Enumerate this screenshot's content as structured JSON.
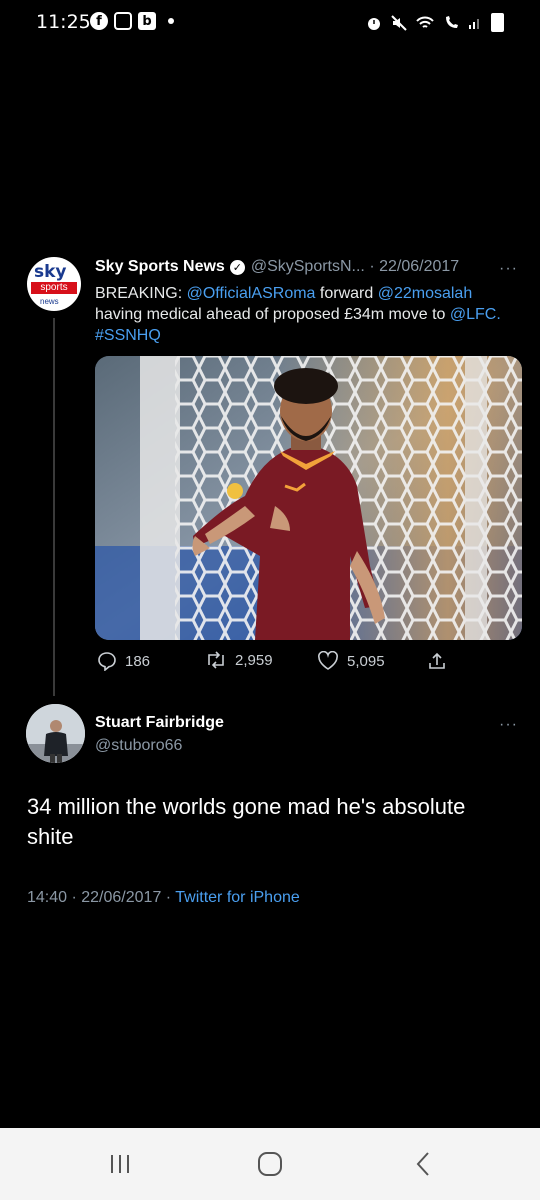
{
  "status_bar": {
    "time": "11:25",
    "left_icons": [
      "facebook-icon",
      "instagram-icon",
      "b-app-icon",
      "notification-dot"
    ],
    "right_icons": [
      "alarm-icon",
      "mute-icon",
      "wifi-icon",
      "wifi-calling-icon",
      "signal-icon",
      "battery-icon"
    ]
  },
  "tweet": {
    "avatar_text": {
      "sky": "sky",
      "sports": "sports",
      "news": "news"
    },
    "author_name": "Sky Sports News",
    "verified": true,
    "handle_and_date": "@SkySportsN... · 22/06/2017",
    "more_label": "···",
    "text": {
      "prefix": "BREAKING: ",
      "mention_1": "@OfficialASRoma",
      "middle_1": " forward ",
      "mention_2": "@22mosalah",
      "middle_2": " having medical ahead of proposed £34m move to ",
      "mention_3": "@LFC.",
      "space": " ",
      "hashtag": "#SSNHQ"
    },
    "stats": {
      "replies": "186",
      "retweets": "2,959",
      "likes": "5,095"
    }
  },
  "reply": {
    "author_name": "Stuart Fairbridge",
    "handle": "@stuboro66",
    "more_label": "···",
    "text": "34 million the worlds gone mad he's absolute shite",
    "time_date": "14:40 · 22/06/2017 · ",
    "source": "Twitter for iPhone"
  },
  "colors": {
    "background": "#000000",
    "link": "#4a9ff0",
    "muted": "#8b98a5",
    "sky_red": "#d7101a",
    "sky_blue": "#1a3a8f",
    "roma_maroon": "#7a1a24"
  },
  "nav_bar": {
    "buttons": [
      "recent-apps-icon",
      "home-icon",
      "back-icon"
    ]
  }
}
